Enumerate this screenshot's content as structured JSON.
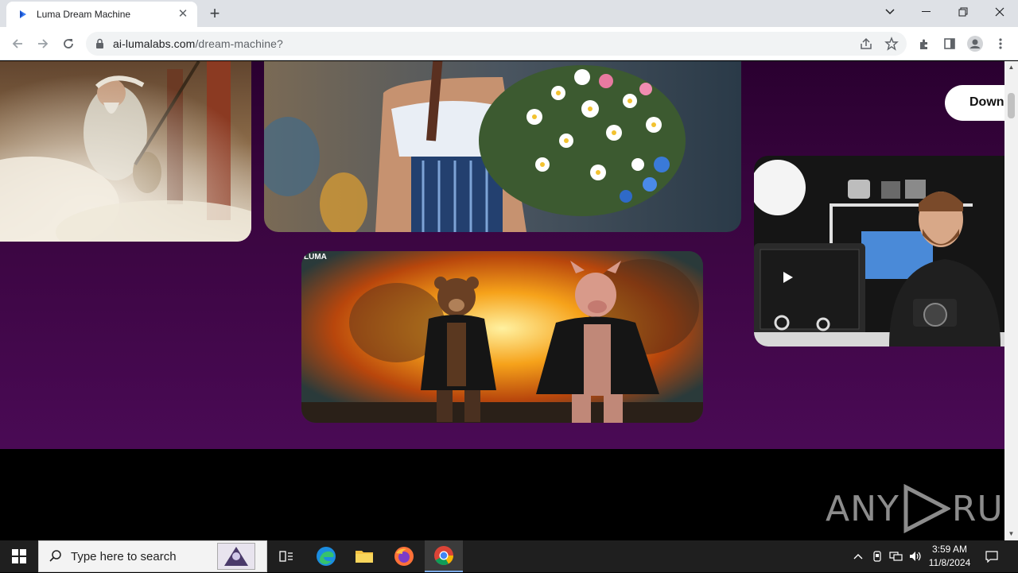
{
  "browser": {
    "tab_title": "Luma Dream Machine",
    "url_domain": "ai-lumalabs.com",
    "url_path": "/dream-machine?"
  },
  "page": {
    "download_label": "Down",
    "video_watermark": "LUMA",
    "images": [
      {
        "subject": "old sage with lute in mist"
      },
      {
        "subject": "woman holding wildflower bouquet"
      },
      {
        "subject": "bear and pig in leather jackets, explosion"
      },
      {
        "subject": "photographer at desk with camera"
      }
    ]
  },
  "watermark": {
    "text_left": "ANY",
    "text_right": "RUN"
  },
  "taskbar": {
    "search_placeholder": "Type here to search",
    "time": "3:59 AM",
    "date": "11/8/2024"
  },
  "colors": {
    "page_purple": "#3a0540",
    "taskbar": "#1f1f1f",
    "chrome_tabbar": "#dee1e6"
  }
}
